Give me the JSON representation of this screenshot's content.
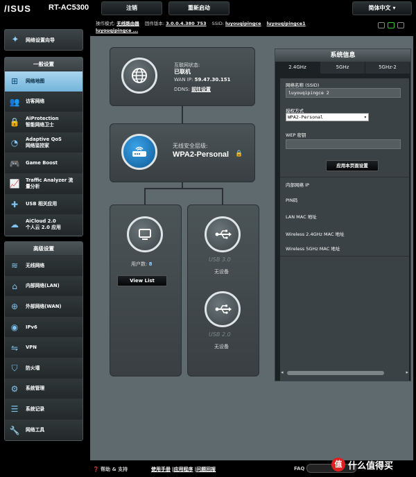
{
  "header": {
    "logo": "/ISUS",
    "model": "RT-AC5300",
    "logout": "注销",
    "reboot": "重新启动",
    "language": "简体中文",
    "mode_label": "操作模式:",
    "mode_value": "无线路由器",
    "firmware_label": "固件版本:",
    "firmware_value": "3.0.0.4.380_753",
    "ssid_label": "SSID:",
    "ssid1": "luyouqipingce",
    "ssid2": "luyouqipingce1",
    "ssid3": "luyouqipingce ..."
  },
  "sidebar": {
    "qis": "网络设置向导",
    "general_title": "一般设置",
    "general": [
      {
        "label": "网络地图",
        "icon": "network-map-icon"
      },
      {
        "label": "访客网络",
        "icon": "guest-network-icon"
      },
      {
        "label": "AiProtection\n智能网络卫士",
        "icon": "aiprotection-icon"
      },
      {
        "label": "Adaptive QoS\n网络监控家",
        "icon": "qos-icon"
      },
      {
        "label": "Game Boost",
        "icon": "gamepad-icon"
      },
      {
        "label": "Traffic Analyzer 流\n量分析",
        "icon": "traffic-icon"
      },
      {
        "label": "USB 相关应用",
        "icon": "usb-app-icon"
      },
      {
        "label": "AiCloud 2.0\n个人云 2.0 应用",
        "icon": "cloud-icon"
      }
    ],
    "advanced_title": "高级设置",
    "advanced": [
      {
        "label": "无线网络",
        "icon": "wireless-icon"
      },
      {
        "label": "内部网络(LAN)",
        "icon": "home-icon"
      },
      {
        "label": "外部网络(WAN)",
        "icon": "globe-icon"
      },
      {
        "label": "IPv6",
        "icon": "ipv6-icon"
      },
      {
        "label": "VPN",
        "icon": "vpn-icon"
      },
      {
        "label": "防火墙",
        "icon": "firewall-icon"
      },
      {
        "label": "系统管理",
        "icon": "admin-icon"
      },
      {
        "label": "系统记录",
        "icon": "log-icon"
      },
      {
        "label": "网络工具",
        "icon": "tools-icon"
      }
    ]
  },
  "map": {
    "internet": {
      "status_label": "互联网状态:",
      "status": "已联机",
      "wan_ip_label": "WAN IP:",
      "wan_ip": "59.47.30.151",
      "ddns_label": "DDNS:",
      "ddns_link": "前往设置"
    },
    "router": {
      "security_label": "无线安全层级:",
      "security": "WPA2-Personal"
    },
    "clients": {
      "count_label": "用户数:",
      "count": "8",
      "view_list": "View List"
    },
    "usb": [
      {
        "label": "USB 3.0",
        "status": "无设备"
      },
      {
        "label": "USB 2.0",
        "status": "无设备"
      }
    ]
  },
  "sysinfo": {
    "title": "系统信息",
    "tabs": [
      "2.4GHz",
      "5GHz",
      "5GHz-2"
    ],
    "ssid_label": "网络名称 (SSID)",
    "ssid_value": "luyouqipingce 2",
    "auth_label": "授权方式",
    "auth_value": "WPA2-Personal",
    "wep_label": "WEP 密钥",
    "apply": "应用本页面设置",
    "lan_ip_label": "内部网络 IP",
    "pin_label": "PIN码",
    "lan_mac_label": "LAN MAC 地址",
    "mac24_label": "Wireless 2.4GHz MAC 地址",
    "mac5_label": "Wireless 5GHz MAC 地址"
  },
  "footer": {
    "help": "帮助 & 支持",
    "manual": "使用手册",
    "utility": "应用程序",
    "feedback": "问题回报",
    "faq": "FAQ",
    "watermark": "什么值得买",
    "watermark_icon": "值"
  }
}
